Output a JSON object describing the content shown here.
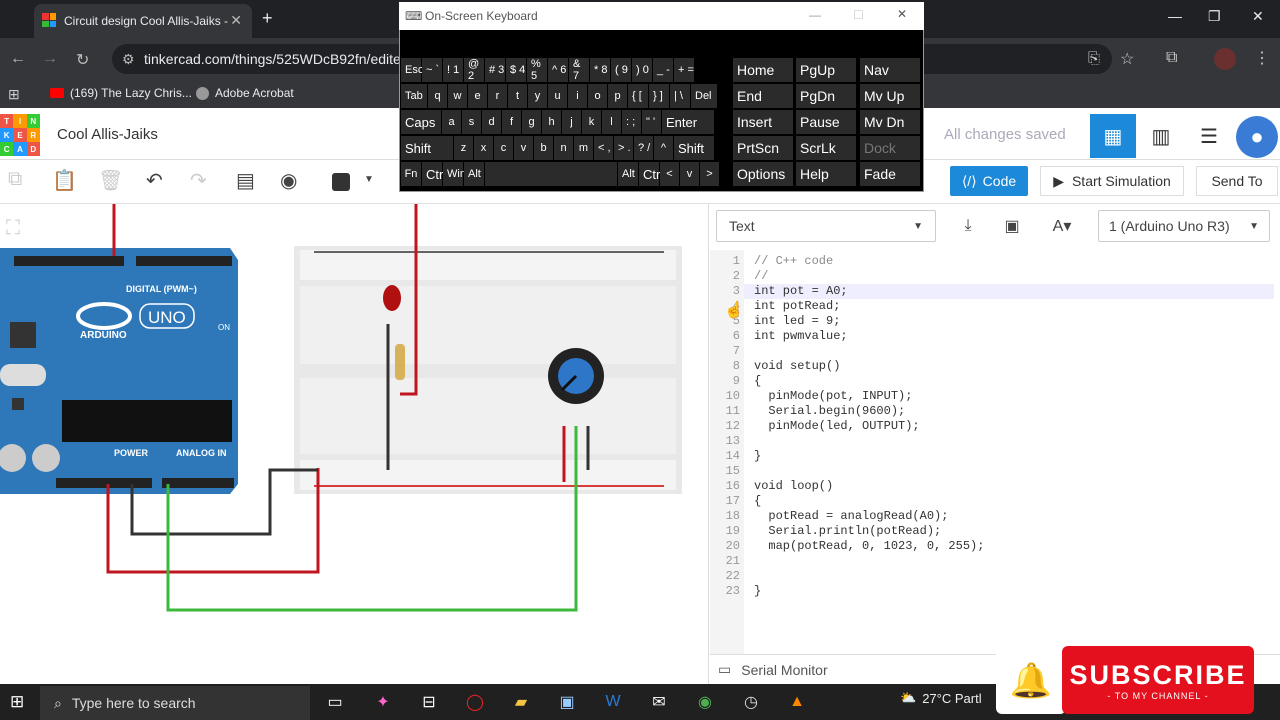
{
  "browser": {
    "tab_title": "Circuit design Cool Allis-Jaiks -",
    "url": "tinkercad.com/things/525WDcB92fn/editel?",
    "bookmarks": [
      {
        "label": "(169) The Lazy Chris..."
      },
      {
        "label": "Adobe Acrobat"
      }
    ]
  },
  "app": {
    "logo_letters": [
      "TIN",
      "KER",
      "CAD"
    ],
    "design_title": "Cool Allis-Jaiks",
    "save_status": "All changes saved"
  },
  "toolbar": {
    "code_label": "Code",
    "start_sim_label": "Start Simulation",
    "send_to_label": "Send To"
  },
  "code_panel": {
    "mode": "Text",
    "board": "1 (Arduino Uno R3)",
    "serial_monitor_label": "Serial Monitor",
    "lines": [
      "// C++ code",
      "//",
      "int pot = A0;",
      "int potRead;",
      "int led = 9;",
      "int pwmvalue;",
      "",
      "void setup()",
      "{",
      "  pinMode(pot, INPUT);",
      "  Serial.begin(9600);",
      "  pinMode(led, OUTPUT);",
      "",
      "}",
      "",
      "void loop()",
      "{",
      "  potRead = analogRead(A0);",
      "  Serial.println(potRead);",
      "  map(potRead, 0, 1023, 0, 255);",
      "",
      "",
      "}"
    ]
  },
  "arduino": {
    "digital_label": "DIGITAL (PWM~)",
    "brand": "ARDUINO",
    "model": "UNO",
    "power_label": "POWER",
    "analog_label": "ANALOG IN",
    "on_label": "ON"
  },
  "osk": {
    "title": "On-Screen Keyboard",
    "rows": [
      [
        "Esc",
        "~ `",
        "! 1",
        "@ 2",
        "# 3",
        "$ 4",
        "% 5",
        "^ 6",
        "& 7",
        "* 8",
        "( 9",
        ") 0",
        "_ -",
        "+ ="
      ],
      [
        "Tab",
        "q",
        "w",
        "e",
        "r",
        "t",
        "y",
        "u",
        "i",
        "o",
        "p",
        "{ [",
        "} ]",
        "| \\",
        "Del"
      ],
      [
        "Caps",
        "a",
        "s",
        "d",
        "f",
        "g",
        "h",
        "j",
        "k",
        "l",
        ": ;",
        "\" '",
        "Enter"
      ],
      [
        "Shift",
        "z",
        "x",
        "c",
        "v",
        "b",
        "n",
        "m",
        "< ,",
        "> .",
        "? /",
        "^",
        "Shift"
      ],
      [
        "Fn",
        "Ctrl",
        "Win",
        "Alt",
        "",
        "Alt",
        "Ctrl",
        "<",
        "v",
        ">"
      ]
    ],
    "nav_keys": [
      [
        "Home",
        "PgUp",
        "Nav"
      ],
      [
        "End",
        "PgDn",
        "Mv Up"
      ],
      [
        "Insert",
        "Pause",
        "Mv Dn"
      ],
      [
        "PrtScn",
        "ScrLk",
        "Dock"
      ],
      [
        "Options",
        "Help",
        "Fade"
      ]
    ]
  },
  "taskbar": {
    "search_placeholder": "Type here to search",
    "weather": "27°C  Partl"
  },
  "promo": {
    "subscribe": "SUBSCRIBE",
    "sub_text": "- TO MY CHANNEL -"
  }
}
